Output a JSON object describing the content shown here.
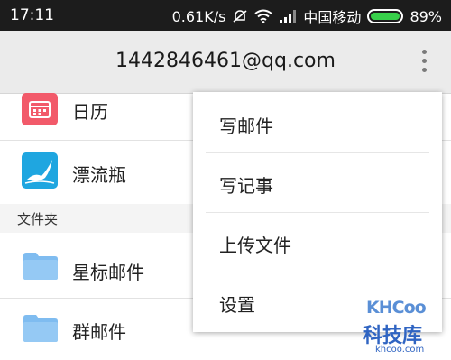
{
  "status_bar": {
    "time": "17:11",
    "speed": "0.61K/s",
    "carrier": "中国移动",
    "battery": "89%",
    "battery_level": 0.89,
    "icons": [
      "mute-icon",
      "wifi-icon",
      "signal-icon",
      "battery-icon"
    ]
  },
  "header": {
    "title": "1442846461@qq.com",
    "more_icon": "more-vert-icon"
  },
  "list": {
    "items": [
      {
        "label": "日历",
        "icon": "calendar-icon",
        "color": "#f25a6a"
      },
      {
        "label": "漂流瓶",
        "icon": "drift-bottle-icon",
        "color": "#1fa6e0"
      }
    ],
    "section_header": "文件夹",
    "folders": [
      {
        "label": "星标邮件",
        "icon": "folder-icon",
        "color": "#7fbcf0"
      },
      {
        "label": "群邮件",
        "icon": "folder-icon",
        "color": "#7fbcf0"
      }
    ]
  },
  "menu": {
    "items": [
      "写邮件",
      "写记事",
      "上传文件",
      "设置"
    ]
  },
  "watermark": {
    "brand": "KHCoo",
    "name": "科技库",
    "url": "khcoo.com"
  }
}
